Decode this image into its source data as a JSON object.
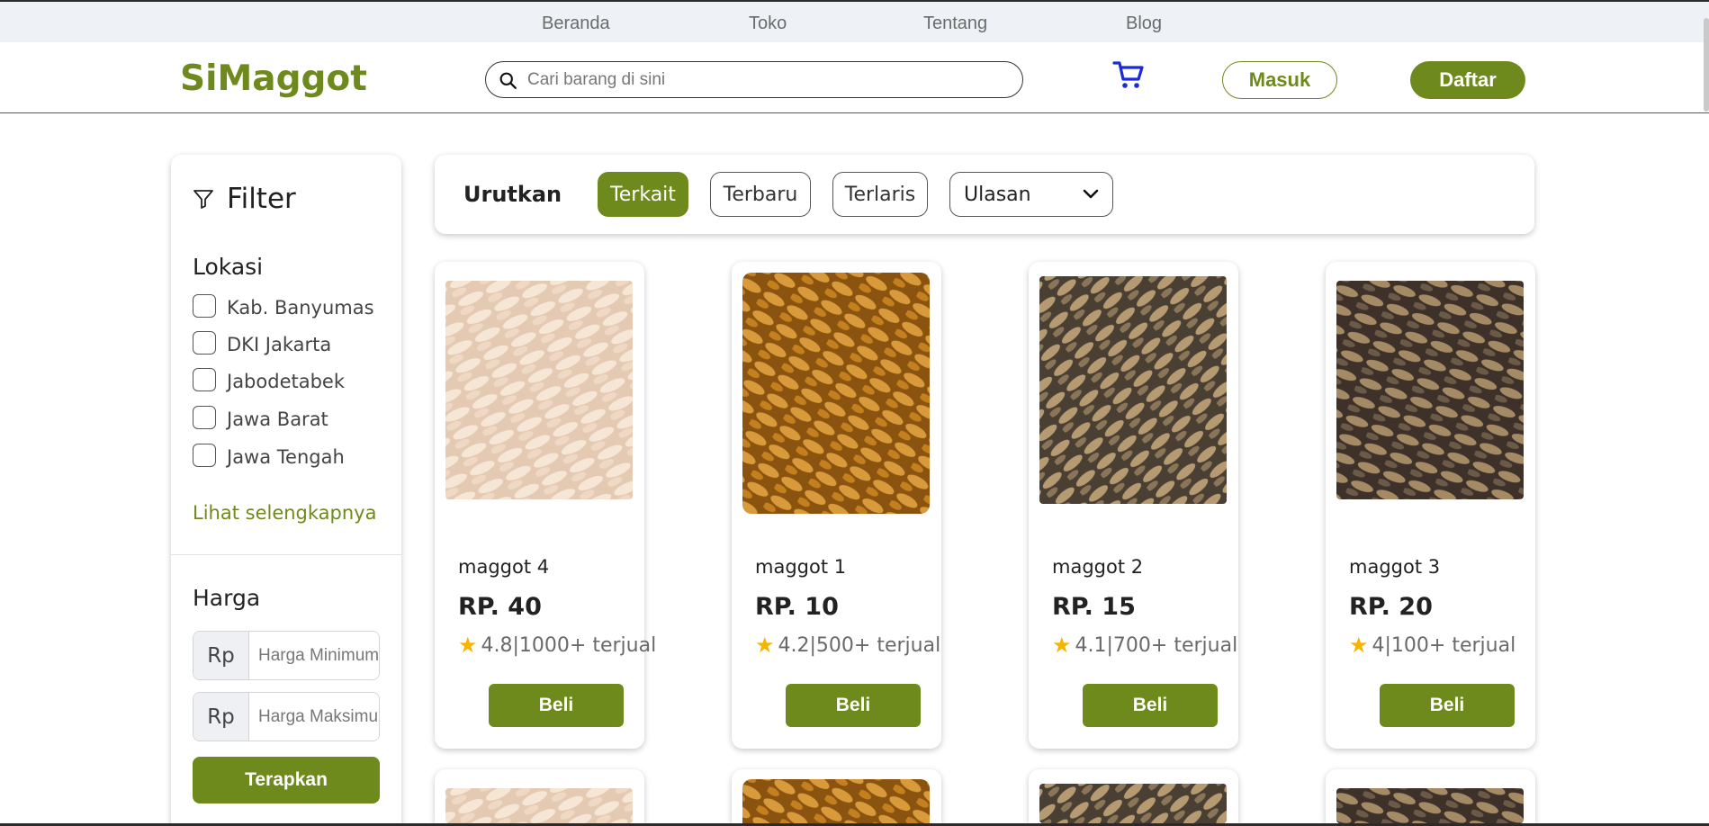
{
  "topnav": {
    "items": [
      "Beranda",
      "Toko",
      "Tentang",
      "Blog"
    ]
  },
  "header": {
    "logo": "SiMaggot",
    "search_placeholder": "Cari barang di sini",
    "login_label": "Masuk",
    "register_label": "Daftar",
    "accent_color": "#6f8a1c"
  },
  "filter": {
    "title": "Filter",
    "location_title": "Lokasi",
    "locations": [
      "Kab. Banyumas",
      "DKI Jakarta",
      "Jabodetabek",
      "Jawa Barat",
      "Jawa Tengah"
    ],
    "see_more": "Lihat selengkapnya",
    "price_title": "Harga",
    "currency_prefix": "Rp",
    "min_placeholder": "Harga Minimum",
    "max_placeholder": "Harga Maksimum",
    "apply_label": "Terapkan"
  },
  "sort": {
    "label": "Urutkan",
    "options": [
      "Terkait",
      "Terbaru",
      "Terlaris"
    ],
    "active": "Terkait",
    "select_value": "Ulasan"
  },
  "products": [
    {
      "name": "maggot 4",
      "price": "RP. 40",
      "rating": "4.8|1000+ terjual",
      "buy_label": "Beli"
    },
    {
      "name": "maggot 1",
      "price": "RP. 10",
      "rating": "4.2|500+ terjual",
      "buy_label": "Beli"
    },
    {
      "name": "maggot 2",
      "price": "RP. 15",
      "rating": "4.1|700+ terjual",
      "buy_label": "Beli"
    },
    {
      "name": "maggot 3",
      "price": "RP. 20",
      "rating": "4|100+ terjual",
      "buy_label": "Beli"
    }
  ]
}
